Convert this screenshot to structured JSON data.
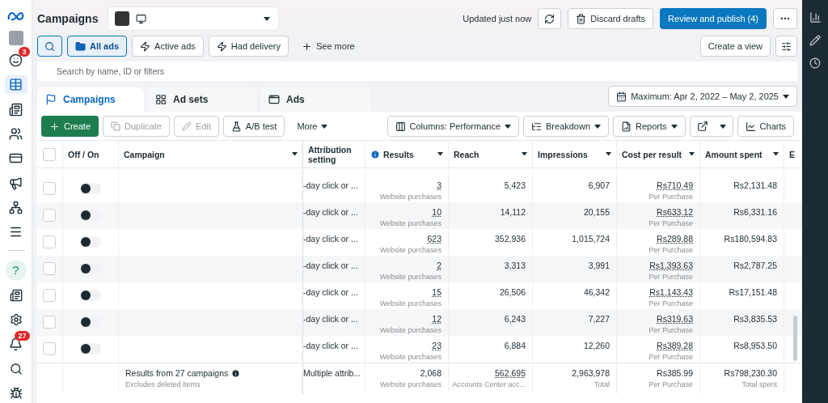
{
  "header": {
    "title": "Campaigns",
    "status": "Updated just now",
    "discard": "Discard drafts",
    "publish": "Review and publish (4)"
  },
  "filters": {
    "items": [
      {
        "label": "All ads",
        "selected": true,
        "kind": "folder"
      },
      {
        "label": "Active ads",
        "selected": false,
        "kind": "bolt"
      },
      {
        "label": "Had delivery",
        "selected": false,
        "kind": "bolt"
      }
    ],
    "see_more": "See more",
    "create_view": "Create a view"
  },
  "search": {
    "placeholder": "Search by name, ID or filters"
  },
  "tabs": [
    {
      "label": "Campaigns",
      "selected": true,
      "kind": "campaign"
    },
    {
      "label": "Ad sets",
      "selected": false,
      "kind": "adset"
    },
    {
      "label": "Ads",
      "selected": false,
      "kind": "ad"
    }
  ],
  "date_range": "Maximum: Apr 2, 2022 – May 2, 2025",
  "toolbar": {
    "create": "Create",
    "duplicate": {
      "label": "Duplicate",
      "disabled": true
    },
    "edit": {
      "label": "Edit",
      "disabled": true
    },
    "ab_test": "A/B test",
    "more": "More",
    "columns": "Columns: Performance",
    "breakdown": "Breakdown",
    "reports": "Reports",
    "charts": "Charts"
  },
  "table": {
    "select_all": {
      "checked": false
    },
    "columns": [
      {
        "label": "Off / On",
        "kind": "plain"
      },
      {
        "label": "Campaign",
        "kind": "menu"
      },
      {
        "label": "Attribution setting",
        "kind": "plain"
      },
      {
        "label": "Results",
        "kind": "info_menu"
      },
      {
        "label": "Reach",
        "kind": "menu"
      },
      {
        "label": "Impressions",
        "kind": "menu"
      },
      {
        "label": "Cost per result",
        "kind": "menu"
      },
      {
        "label": "Amount spent",
        "kind": "menu"
      },
      {
        "label": "E",
        "kind": "plain"
      }
    ],
    "rows": [
      {
        "checked": false,
        "on": false,
        "attribution": "-day click or ...",
        "results": "3",
        "results_label": "Website purchases",
        "reach": "5,423",
        "impressions": "6,907",
        "cost": "Rs710.49",
        "cost_label": "Per Purchase",
        "amount": "Rs2,131.48"
      },
      {
        "checked": false,
        "on": false,
        "attribution": "-day click or ...",
        "results": "10",
        "results_label": "Website purchases",
        "reach": "14,112",
        "impressions": "20,155",
        "cost": "Rs633.12",
        "cost_label": "Per Purchase",
        "amount": "Rs6,331.16"
      },
      {
        "checked": false,
        "on": false,
        "attribution": "-day click or ...",
        "results": "623",
        "results_label": "Website purchases",
        "reach": "352,936",
        "impressions": "1,015,724",
        "cost": "Rs289.88",
        "cost_label": "Per Purchase",
        "amount": "Rs180,594.83"
      },
      {
        "checked": false,
        "on": false,
        "attribution": "-day click or ...",
        "results": "2",
        "results_label": "Website purchases",
        "reach": "3,313",
        "impressions": "3,991",
        "cost": "Rs1,393.63",
        "cost_label": "Per Purchase",
        "amount": "Rs2,787.25"
      },
      {
        "checked": false,
        "on": false,
        "attribution": "-day click or ...",
        "results": "15",
        "results_label": "Website purchases",
        "reach": "26,506",
        "impressions": "46,342",
        "cost": "Rs1,143.43",
        "cost_label": "Per Purchase",
        "amount": "Rs17,151.48"
      },
      {
        "checked": false,
        "on": false,
        "attribution": "-day click or ...",
        "results": "12",
        "results_label": "Website purchases",
        "reach": "6,243",
        "impressions": "7,227",
        "cost": "Rs319.63",
        "cost_label": "Per Purchase",
        "amount": "Rs3,835.53"
      },
      {
        "checked": false,
        "on": false,
        "attribution": "-day click or ...",
        "results": "23",
        "results_label": "Website purchases",
        "reach": "6,884",
        "impressions": "12,260",
        "cost": "Rs389.28",
        "cost_label": "Per Purchase",
        "amount": "Rs8,953.50"
      }
    ],
    "footer": {
      "summary": "Results from 27 campaigns",
      "note": "Excludes deleted items",
      "attribution": "Multiple attrib...",
      "results": "2,068",
      "results_label": "Website purchases",
      "reach": "562,695",
      "reach_label": "Accounts Center acc...",
      "impressions": "2,963,978",
      "impressions_label": "Total",
      "cost": "Rs385.99",
      "cost_label": "Per Purchase",
      "amount": "Rs798,230.30",
      "amount_label": "Total spent"
    }
  },
  "nav": {
    "badges": [
      {
        "kind": "face",
        "count": "3"
      },
      {
        "kind": "bell",
        "count": "27"
      }
    ],
    "help": "?"
  }
}
